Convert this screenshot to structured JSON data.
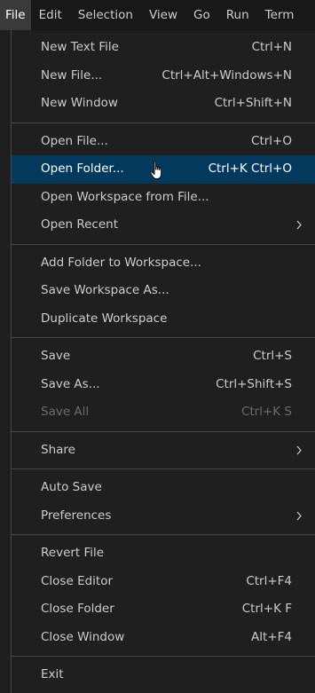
{
  "menubar": {
    "items": [
      {
        "label": "File"
      },
      {
        "label": "Edit"
      },
      {
        "label": "Selection"
      },
      {
        "label": "View"
      },
      {
        "label": "Go"
      },
      {
        "label": "Run"
      },
      {
        "label": "Term"
      }
    ]
  },
  "file_menu": {
    "groups": [
      [
        {
          "label": "New Text File",
          "shortcut": "Ctrl+N"
        },
        {
          "label": "New File...",
          "shortcut": "Ctrl+Alt+Windows+N"
        },
        {
          "label": "New Window",
          "shortcut": "Ctrl+Shift+N"
        }
      ],
      [
        {
          "label": "Open File...",
          "shortcut": "Ctrl+O"
        },
        {
          "label": "Open Folder...",
          "shortcut": "Ctrl+K Ctrl+O",
          "highlighted": true
        },
        {
          "label": "Open Workspace from File...",
          "shortcut": ""
        },
        {
          "label": "Open Recent",
          "shortcut": "",
          "submenu": true
        }
      ],
      [
        {
          "label": "Add Folder to Workspace...",
          "shortcut": ""
        },
        {
          "label": "Save Workspace As...",
          "shortcut": ""
        },
        {
          "label": "Duplicate Workspace",
          "shortcut": ""
        }
      ],
      [
        {
          "label": "Save",
          "shortcut": "Ctrl+S"
        },
        {
          "label": "Save As...",
          "shortcut": "Ctrl+Shift+S"
        },
        {
          "label": "Save All",
          "shortcut": "Ctrl+K S",
          "disabled": true
        }
      ],
      [
        {
          "label": "Share",
          "shortcut": "",
          "submenu": true
        }
      ],
      [
        {
          "label": "Auto Save",
          "shortcut": ""
        },
        {
          "label": "Preferences",
          "shortcut": "",
          "submenu": true
        }
      ],
      [
        {
          "label": "Revert File",
          "shortcut": ""
        },
        {
          "label": "Close Editor",
          "shortcut": "Ctrl+F4"
        },
        {
          "label": "Close Folder",
          "shortcut": "Ctrl+K F"
        },
        {
          "label": "Close Window",
          "shortcut": "Alt+F4"
        }
      ],
      [
        {
          "label": "Exit",
          "shortcut": ""
        }
      ]
    ]
  },
  "colors": {
    "menu_bg": "#1f1f1f",
    "highlight_bg": "#04395e",
    "separator": "#454545",
    "text": "#cccccc",
    "disabled_text": "#6b6b6b"
  },
  "icons": {
    "submenu": "chevron-right-icon",
    "cursor": "hand-pointer-icon"
  }
}
